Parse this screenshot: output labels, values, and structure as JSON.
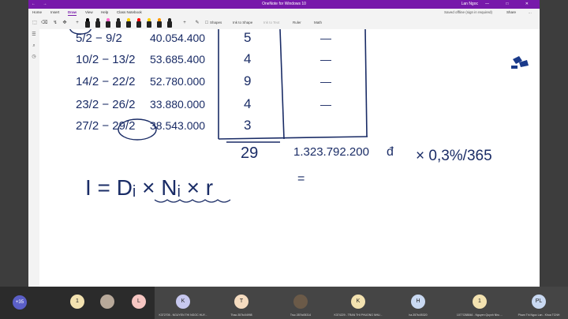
{
  "window": {
    "title": "OneNote for Windows 10",
    "user": "Lan Ngoc",
    "nav_glyphs": "← →",
    "controls": "— □ ✕"
  },
  "ribbon": {
    "tabs": [
      "Home",
      "Insert",
      "Draw",
      "View",
      "Help",
      "Class Notebook"
    ],
    "active_tab": "Draw",
    "status": "Saved offline (sign in required)",
    "share_label": "Share",
    "more_label": "…"
  },
  "toolbar": {
    "pens": [
      {
        "tip": "#000000"
      },
      {
        "tip": "#222222"
      },
      {
        "tip": "#ff66cc"
      },
      {
        "tip": "#222222"
      },
      {
        "tip": "#ffd000"
      },
      {
        "tip": "#ff0000"
      },
      {
        "tip": "#ffd000"
      },
      {
        "tip": "#ff9900"
      },
      {
        "tip": "#222222"
      }
    ],
    "shapes_label": "Shapes",
    "ink_to_shape_label": "Ink to Shape",
    "ink_to_text_label": "Ink to Text",
    "ruler_label": "Ruler",
    "math_label": "Math"
  },
  "notes": {
    "rows": [
      {
        "dates": "5/2 − 9/2",
        "amount": "40.054.400",
        "days": "5",
        "mark": "—"
      },
      {
        "dates": "10/2 − 13/2",
        "amount": "53.685.400",
        "days": "4",
        "mark": "—"
      },
      {
        "dates": "14/2 − 22/2",
        "amount": "52.780.000",
        "days": "9",
        "mark": "—"
      },
      {
        "dates": "23/2 − 26/2",
        "amount": "33.880.000",
        "days": "4",
        "mark": "—"
      },
      {
        "dates": "27/2 − 29/2",
        "amount": "38.543.000",
        "days": "3",
        "mark": ""
      }
    ],
    "total_days": "29",
    "total_amount": "1.323.792.200",
    "currency": "đ",
    "rate_expr": "× 0,3%/365",
    "formula": "I = Dᵢ × Nᵢ × r",
    "equals": "="
  },
  "participants": {
    "more_count": "+35",
    "tiles": [
      {
        "initial": "1",
        "name": "",
        "color": "#f3e2b0"
      },
      {
        "initial": "",
        "name": "",
        "color": "#b8a99a"
      },
      {
        "initial": "L",
        "name": "",
        "color": "#f6c6c2"
      },
      {
        "initial": "K",
        "name": "K372705 - NGUYEN THI NGOC HUY...",
        "color": "#c7c8ef"
      },
      {
        "initial": "T",
        "name": "Thao.357tc04998",
        "color": "#f5dcc0"
      },
      {
        "initial": "",
        "name": "Truc.357tc05314",
        "color": "#6b5a48"
      },
      {
        "initial": "K",
        "name": "K374229 - TRAN THI PHUONG NHU...",
        "color": "#f3e2b0"
      },
      {
        "initial": "H",
        "name": "ha.357tc05320",
        "color": "#c9d9f2"
      },
      {
        "initial": "1",
        "name": "1077CB8846 - Nguyen Quynh Nhu ...",
        "color": "#f3e2b0"
      },
      {
        "initial": "PL",
        "name": "Pham Thi Ngoc Lan - Khoa TCNH",
        "color": "#c9d9f2"
      }
    ]
  }
}
